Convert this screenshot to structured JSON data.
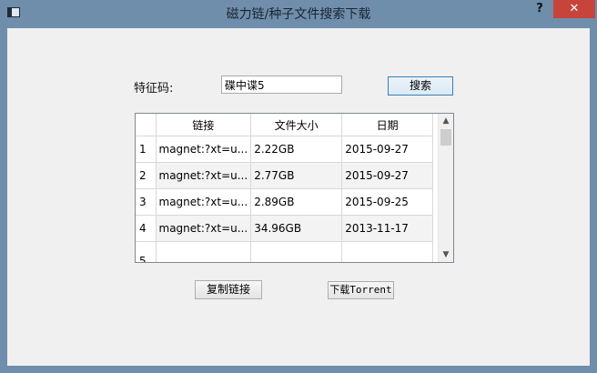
{
  "window": {
    "title": "磁力链/种子文件搜索下载",
    "help_label": "?",
    "close_label": "✕"
  },
  "search": {
    "label": "特征码:",
    "value": "碟中谍5",
    "button": "搜索"
  },
  "table": {
    "headers": [
      "链接",
      "文件大小",
      "日期"
    ],
    "rows": [
      {
        "num": "1",
        "link": "magnet:?xt=u...",
        "size": "2.22GB",
        "date": "2015-09-27"
      },
      {
        "num": "2",
        "link": "magnet:?xt=u...",
        "size": "2.77GB",
        "date": "2015-09-27"
      },
      {
        "num": "3",
        "link": "magnet:?xt=u...",
        "size": "2.89GB",
        "date": "2015-09-25"
      },
      {
        "num": "4",
        "link": "magnet:?xt=u...",
        "size": "34.96GB",
        "date": "2013-11-17"
      },
      {
        "num": "5",
        "link": "",
        "size": "",
        "date": ""
      }
    ]
  },
  "actions": {
    "copy": "复制链接",
    "download": "下载Torrent"
  }
}
